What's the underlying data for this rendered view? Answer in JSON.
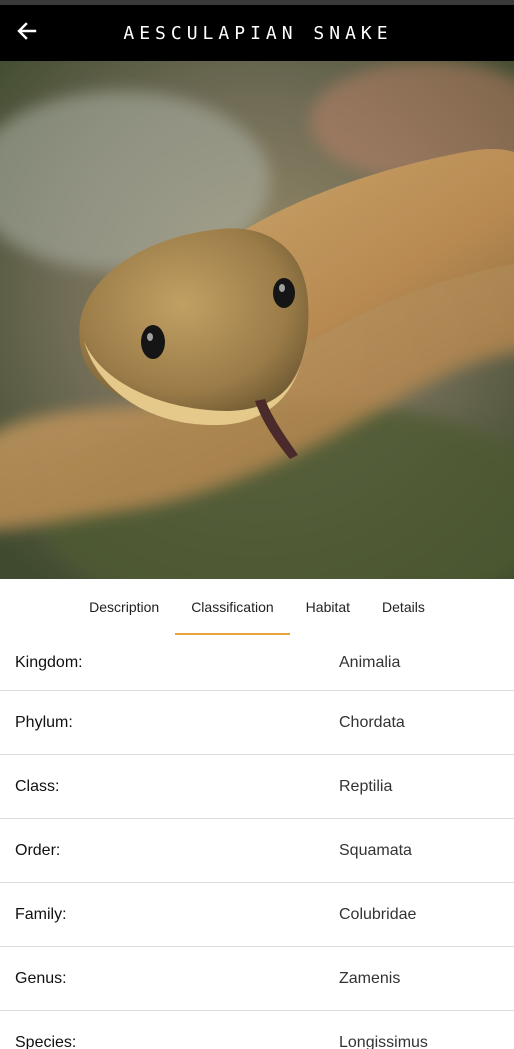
{
  "app_bar": {
    "title": "AESCULAPIAN SNAKE",
    "back_icon": "arrow-left-icon"
  },
  "hero": {
    "image_subject": "aesculapian-snake-photo"
  },
  "tabs": [
    {
      "label": "Description",
      "active": false
    },
    {
      "label": "Classification",
      "active": true
    },
    {
      "label": "Habitat",
      "active": false
    },
    {
      "label": "Details",
      "active": false
    }
  ],
  "classification": [
    {
      "label": "Kingdom:",
      "value": "Animalia"
    },
    {
      "label": "Phylum:",
      "value": "Chordata"
    },
    {
      "label": "Class:",
      "value": "Reptilia"
    },
    {
      "label": "Order:",
      "value": "Squamata"
    },
    {
      "label": "Family:",
      "value": "Colubridae"
    },
    {
      "label": "Genus:",
      "value": "Zamenis"
    },
    {
      "label": "Species:",
      "value": "Longissimus"
    }
  ],
  "colors": {
    "app_bar_bg": "#000000",
    "tab_indicator": "#e8a33b"
  }
}
